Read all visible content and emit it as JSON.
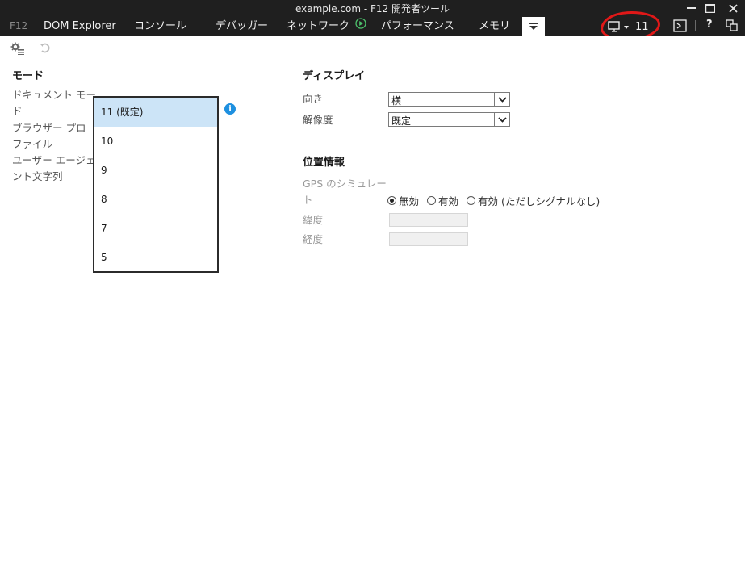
{
  "window": {
    "title": "example.com - F12 開発者ツール"
  },
  "tabs": [
    {
      "label": "F12"
    },
    {
      "label": "DOM Explorer"
    },
    {
      "label": "コンソール"
    },
    {
      "label": "デバッガー"
    },
    {
      "label": "ネットワーク"
    },
    {
      "label": "パフォーマンス"
    },
    {
      "label": "メモリ"
    }
  ],
  "emulation_tab": {
    "label": "11",
    "icon": "monitor-icon"
  },
  "toolbar": {
    "icons": [
      "settings-icon",
      "undo-icon"
    ]
  },
  "mode": {
    "title": "モード",
    "document_mode_label_1": "ドキュメント モー",
    "document_mode_label_2": "ド",
    "browser_profile_label_1": "ブラウザー プロ",
    "browser_profile_label_2": "ファイル",
    "user_agent_label_1": "ユーザー エージェ",
    "user_agent_label_2": "ント文字列",
    "dropdown_options": [
      "11 (既定)",
      "10",
      "9",
      "8",
      "7",
      "5"
    ],
    "selected_index": 0
  },
  "display": {
    "title": "ディスプレイ",
    "orientation_label": "向き",
    "orientation_value": "横",
    "resolution_label": "解像度",
    "resolution_value": "既定"
  },
  "geolocation": {
    "title": "位置情報",
    "gps_label_1": "GPS のシミュレー",
    "gps_label_2": "ト",
    "options": [
      "無効",
      "有効",
      "有効 (ただしシグナルなし)"
    ],
    "selected_index": 0,
    "latitude_label": "緯度",
    "longitude_label": "経度",
    "latitude_value": "",
    "longitude_value": ""
  },
  "colors": {
    "chrome_bg": "#1f1f1f",
    "selection": "#cce4f7",
    "annotation": "#e01818",
    "info": "#1e90e0"
  }
}
